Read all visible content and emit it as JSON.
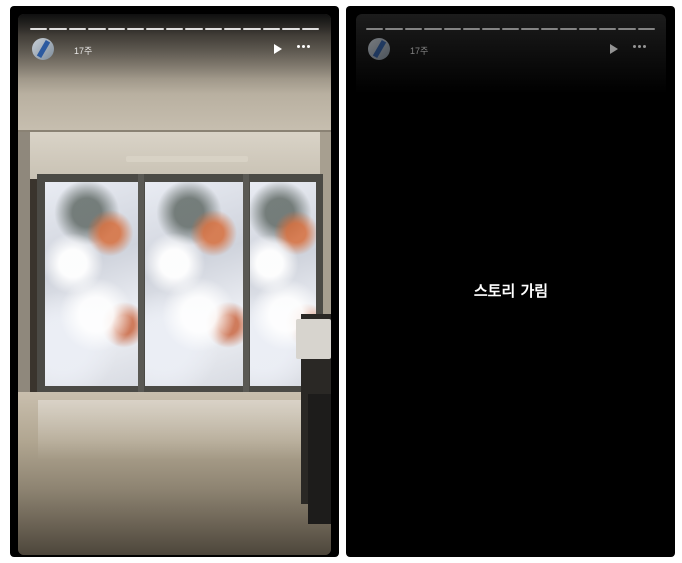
{
  "stories": [
    {
      "time": "17주",
      "progress_segments": 15
    },
    {
      "time": "17주",
      "progress_segments": 15,
      "hidden_message": "스토리 가림"
    }
  ],
  "colors": {
    "background": "#ffffff",
    "panel": "#000000",
    "text": "#ffffff"
  },
  "icons": {
    "play": "play-icon",
    "more": "more-icon"
  }
}
